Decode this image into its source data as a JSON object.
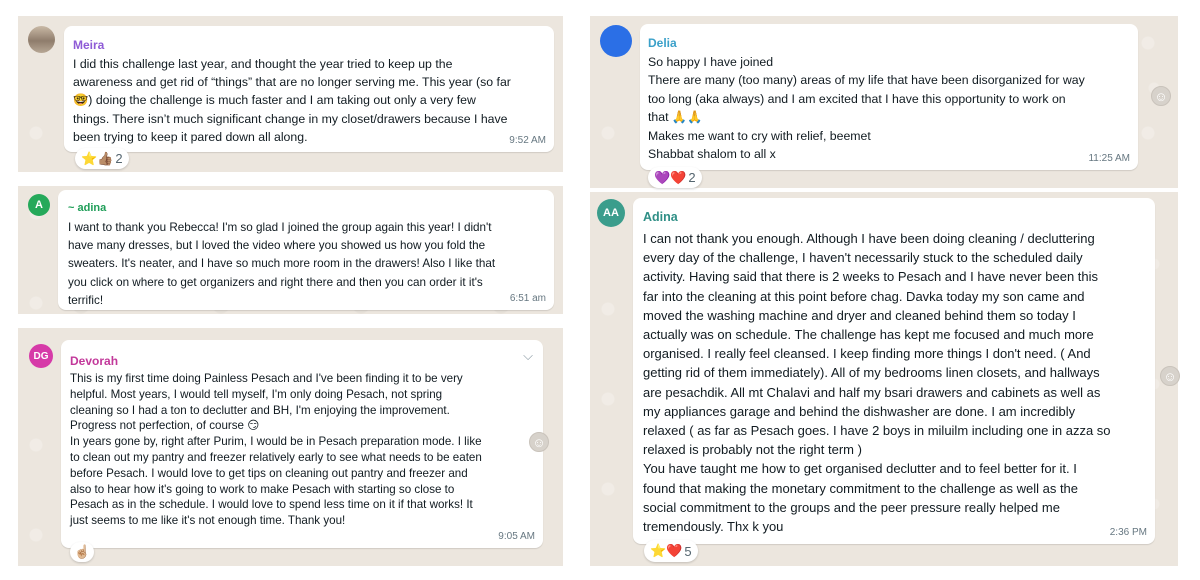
{
  "messages": [
    {
      "sender": "Meira",
      "text": "I did this challenge last year, and thought the year tried to keep up the\nawareness and get rid of “things” that are no longer serving me. This year (so far\n🤓) doing the challenge is much faster and I am taking out only a very few\nthings. There isn’t much significant change in my closet/drawers because I have\nbeen trying to keep it pared down all along.",
      "time": "9:52 AM",
      "reactions": "⭐👍🏽",
      "reaction_count": "2"
    },
    {
      "avatar_initials": "A",
      "sender": "~ adina",
      "text": "I want to thank you Rebecca! I'm so glad I joined the group again this year! I didn't\nhave many dresses, but I loved the video where you showed us how you fold the\nsweaters. It's neater, and I have so much more room in the drawers! Also I like that\nyou click on where to get organizers and right there and then you can order it it's\nterrific!",
      "time": "6:51 am"
    },
    {
      "avatar_initials": "DG",
      "sender": "Devorah",
      "text": "This is my first time doing Painless Pesach and I've been finding it to be very\nhelpful. Most years, I would tell myself, I'm only doing Pesach, not spring\ncleaning so I had a ton to declutter and BH, I'm enjoying the improvement.\nProgress not perfection, of course 😏\nIn years gone by, right after Purim, I would be in Pesach preparation mode.  I like\nto clean out my pantry and freezer relatively early to see what needs to be eaten\nbefore Pesach.  I would love to get tips on cleaning out pantry and freezer and\nalso to hear how it's going to work to make Pesach with starting so close to\nPesach as in the schedule.  I would love to spend less time on it if that works!  It\njust seems to me like it's not enough time.  Thank you!",
      "time": "9:05 AM",
      "reactions": "☝🏼"
    },
    {
      "sender": "Delia",
      "text": "So happy I have joined\nThere are many (too many) areas of my life that have been disorganized for way\ntoo long (aka always) and I am excited that I have this opportunity to work on\nthat 🙏🙏\nMakes me want to cry with relief, beemet\nShabbat shalom to all x",
      "time": "11:25 AM",
      "reactions": "💜❤️",
      "reaction_count": "2"
    },
    {
      "avatar_initials": "AA",
      "sender": "Adina",
      "text": "I can not thank you enough. Although I have been doing cleaning / decluttering\nevery day of the challenge, I haven't necessarily stuck to the scheduled daily\nactivity. Having said that there is 2 weeks to Pesach and I have never been this\nfar into the cleaning at this point before chag. Davka today my son came and\nmoved the washing machine and dryer and cleaned behind them so today I\nactually was on schedule. The challenge has kept me focused and much more\norganised. I really feel cleansed. I keep finding more things I don't need. ( And\ngetting rid of them immediately). All of my bedrooms linen closets, and hallways\nare pesachdik. All mt Chalavi and half my bsari drawers and cabinets as well as\nmy appliances garage and behind the dishwasher are done. I am incredibly\nrelaxed ( as far as Pesach goes. I have 2 boys in miluilm including one in azza so\nrelaxed is probably not the right term )\n You have taught me how to get organised declutter and to feel better for it. I\nfound that making the monetary commitment to the challenge as well as the\nsocial commitment to the groups and  the peer pressure really helped me\ntremendously. Thx k you",
      "time": "2:36 PM",
      "reactions": "⭐❤️",
      "reaction_count": "5"
    }
  ],
  "icons": {
    "react_button": "smiley-icon",
    "menu": "chevron-down-icon"
  },
  "colors": {
    "panel_bg": "#ece6de",
    "bubble_bg": "#ffffff",
    "meira_name": "#8e5bd6",
    "adina_avatar": "#25a95a",
    "adina_name": "#1f9e58",
    "devorah_avatar": "#d63aa8",
    "devorah_name": "#c2389a",
    "delia_avatar": "#2b6fe6",
    "delia_name": "#3aa0c9",
    "aa_avatar": "#3b9d8c",
    "aa_name": "#2f8f86"
  }
}
